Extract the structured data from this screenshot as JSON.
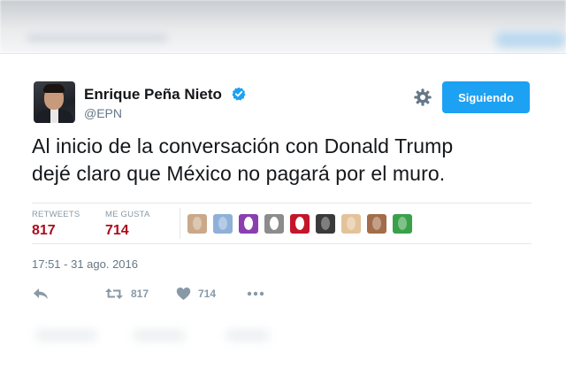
{
  "profile": {
    "name": "Enrique Peña Nieto",
    "handle": "@EPN",
    "verified_icon": "verified-badge-icon"
  },
  "header": {
    "follow_label": "Siguiendo",
    "settings_icon": "gear-icon"
  },
  "tweet": {
    "line1": "Al inicio de la conversación con Donald Trump",
    "line2": "dejé claro que México no pagará por el muro."
  },
  "stats": {
    "retweets_label": "RETWEETS",
    "retweets_value": "817",
    "likes_label": "ME GUSTA",
    "likes_value": "714"
  },
  "likers": [
    {
      "color": "#c9a98a"
    },
    {
      "color": "#8fb0d8"
    },
    {
      "color": "#8a3fb0"
    },
    {
      "color": "#8c8c8c"
    },
    {
      "color": "#c4162a"
    },
    {
      "color": "#3a3a3a"
    },
    {
      "color": "#e3c39a"
    },
    {
      "color": "#a36c4a"
    },
    {
      "color": "#3aa14a"
    }
  ],
  "timestamp": "17:51 - 31 ago. 2016",
  "actions": {
    "reply_icon": "reply-icon",
    "retweet_icon": "retweet-icon",
    "retweet_count": "817",
    "like_icon": "heart-icon",
    "like_count": "714",
    "more_icon": "more-dots-icon"
  },
  "colors": {
    "accent": "#1da1f2",
    "stat_value": "#aa0c1c",
    "muted": "#657786"
  }
}
